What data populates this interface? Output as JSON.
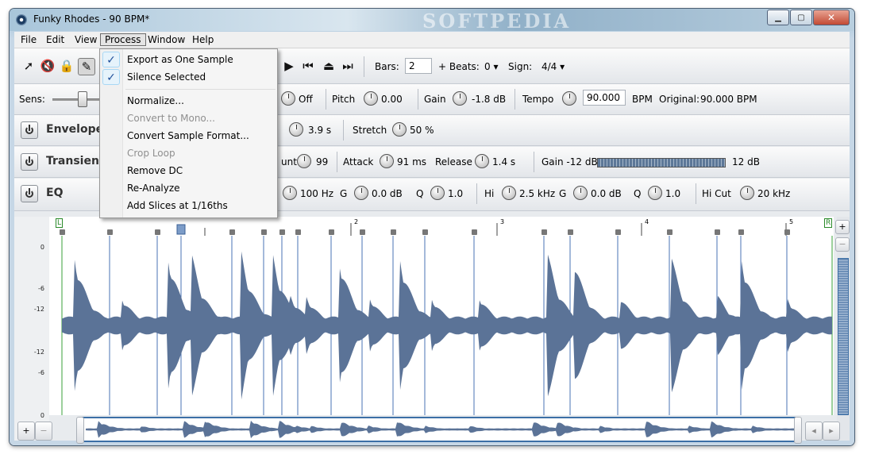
{
  "window": {
    "title": "Funky Rhodes - 90 BPM*",
    "watermark": "SOFTPEDIA",
    "controls": {
      "minimize": "▁",
      "maximize": "▢",
      "close": "✕"
    }
  },
  "menubar": {
    "items": [
      "File",
      "Edit",
      "View",
      "Process",
      "Window",
      "Help"
    ],
    "active": "Process"
  },
  "process_menu": {
    "items": [
      {
        "label": "Export as One Sample",
        "checked": true,
        "enabled": true
      },
      {
        "label": "Silence Selected",
        "checked": true,
        "enabled": true
      },
      {
        "label": "Normalize...",
        "checked": false,
        "enabled": true
      },
      {
        "label": "Convert to Mono...",
        "checked": false,
        "enabled": false
      },
      {
        "label": "Convert Sample Format...",
        "checked": false,
        "enabled": true
      },
      {
        "label": "Crop Loop",
        "checked": false,
        "enabled": false
      },
      {
        "label": "Remove DC",
        "checked": false,
        "enabled": true
      },
      {
        "label": "Re-Analyze",
        "checked": false,
        "enabled": true
      },
      {
        "label": "Add Slices at 1/16ths",
        "checked": false,
        "enabled": true
      }
    ],
    "check_glyph": "✓"
  },
  "toolbar": {
    "tool_icons": [
      "pointer-icon",
      "mute-icon",
      "lock-icon",
      "pencil-icon"
    ],
    "transport_icons": [
      "play-icon",
      "skip-back-icon",
      "eject-icon",
      "skip-forward-icon"
    ],
    "bars_label": "Bars:",
    "bars_value": "2",
    "beats_label": "+ Beats:",
    "beats_value": "0",
    "sign_label": "Sign:",
    "sign_value": "4/4",
    "dropdown_glyph": "▾"
  },
  "row_sens": {
    "sens_label": "Sens:",
    "off_label": "Off",
    "pitch_label": "Pitch",
    "pitch_value": "0.00",
    "gain_label": "Gain",
    "gain_value": "-1.8 dB",
    "tempo_label": "Tempo",
    "tempo_value": "90.000",
    "bpm_label": "BPM",
    "original_label": "Original:",
    "original_value": "90.000 BPM"
  },
  "row_envelope": {
    "title": "Envelope",
    "time_value": "3.9 s",
    "stretch_label": "Stretch",
    "stretch_value": "50 %"
  },
  "row_transient": {
    "title": "Transient",
    "count_label": "unt",
    "count_value": "99",
    "attack_label": "Attack",
    "attack_value": "91 ms",
    "release_label": "Release",
    "release_value": "1.4 s",
    "gain_label": "Gain -12 dB",
    "gain_max": "12 dB"
  },
  "row_eq": {
    "title": "EQ",
    "lo_freq": "100 Hz",
    "g_label": "G",
    "lo_gain": "0.0 dB",
    "q_label": "Q",
    "lo_q": "1.0",
    "hi_label": "Hi",
    "hi_freq": "2.5 kHz",
    "hi_gain": "0.0 dB",
    "hi_q": "1.0",
    "hicut_label": "Hi Cut",
    "hicut_value": "20 kHz"
  },
  "ruler": {
    "start_marker": "L",
    "end_marker": "R",
    "bar_numbers": [
      "2",
      "3",
      "4",
      "5"
    ]
  },
  "amplitude_labels": [
    "0",
    "-6",
    "-12",
    "-12",
    "-6",
    "0"
  ],
  "zoom": {
    "in": "+",
    "out": "−"
  },
  "scroll": {
    "left": "◂",
    "right": "▸"
  }
}
